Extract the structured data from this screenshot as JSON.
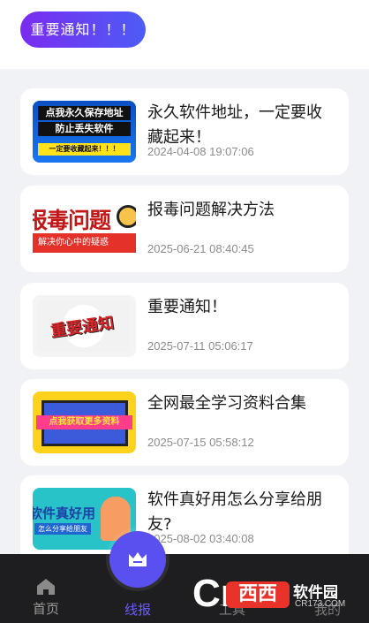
{
  "header": {
    "notice_button": "重要通知！！！"
  },
  "articles": [
    {
      "title": "永久软件地址，一定要收藏起来！",
      "time": "2024-04-08 19:07:06",
      "thumb": {
        "line1": "点我永久保存地址",
        "line2": "防止丢失软件",
        "line3": "一定要收藏起来！！！"
      }
    },
    {
      "title": "报毒问题解决方法",
      "time": "2025-06-21 08:40:45",
      "thumb": {
        "line1": "报毒问题",
        "line2": "解决你心中的疑惑"
      }
    },
    {
      "title": "重要通知！",
      "time": "2025-07-11 05:06:17",
      "thumb": {
        "line1": "重要通知"
      }
    },
    {
      "title": "全网最全学习资料合集",
      "time": "2025-07-15 05:58:12",
      "thumb": {
        "line1": "点我获取更多资料"
      }
    },
    {
      "title": "软件真好用怎么分享给朋友?",
      "time": "2025-08-02 03:40:08",
      "thumb": {
        "line1": "软件真好用",
        "line2": "怎么分享给朋友"
      }
    }
  ],
  "bottom_nav": {
    "home": "首页",
    "report": "线报",
    "tools": "工具",
    "mine": "我的",
    "icons": {
      "home": "home-icon",
      "report": "crown-icon"
    }
  },
  "watermark": {
    "c": "Cr",
    "brand": "西西",
    "soft": "软件园",
    "url": "CR173.COM"
  },
  "colors": {
    "accent": "#5a50ef",
    "pill_start": "#7a2cf0",
    "pill_end": "#4d5cf6",
    "bar": "#1e1e20"
  }
}
